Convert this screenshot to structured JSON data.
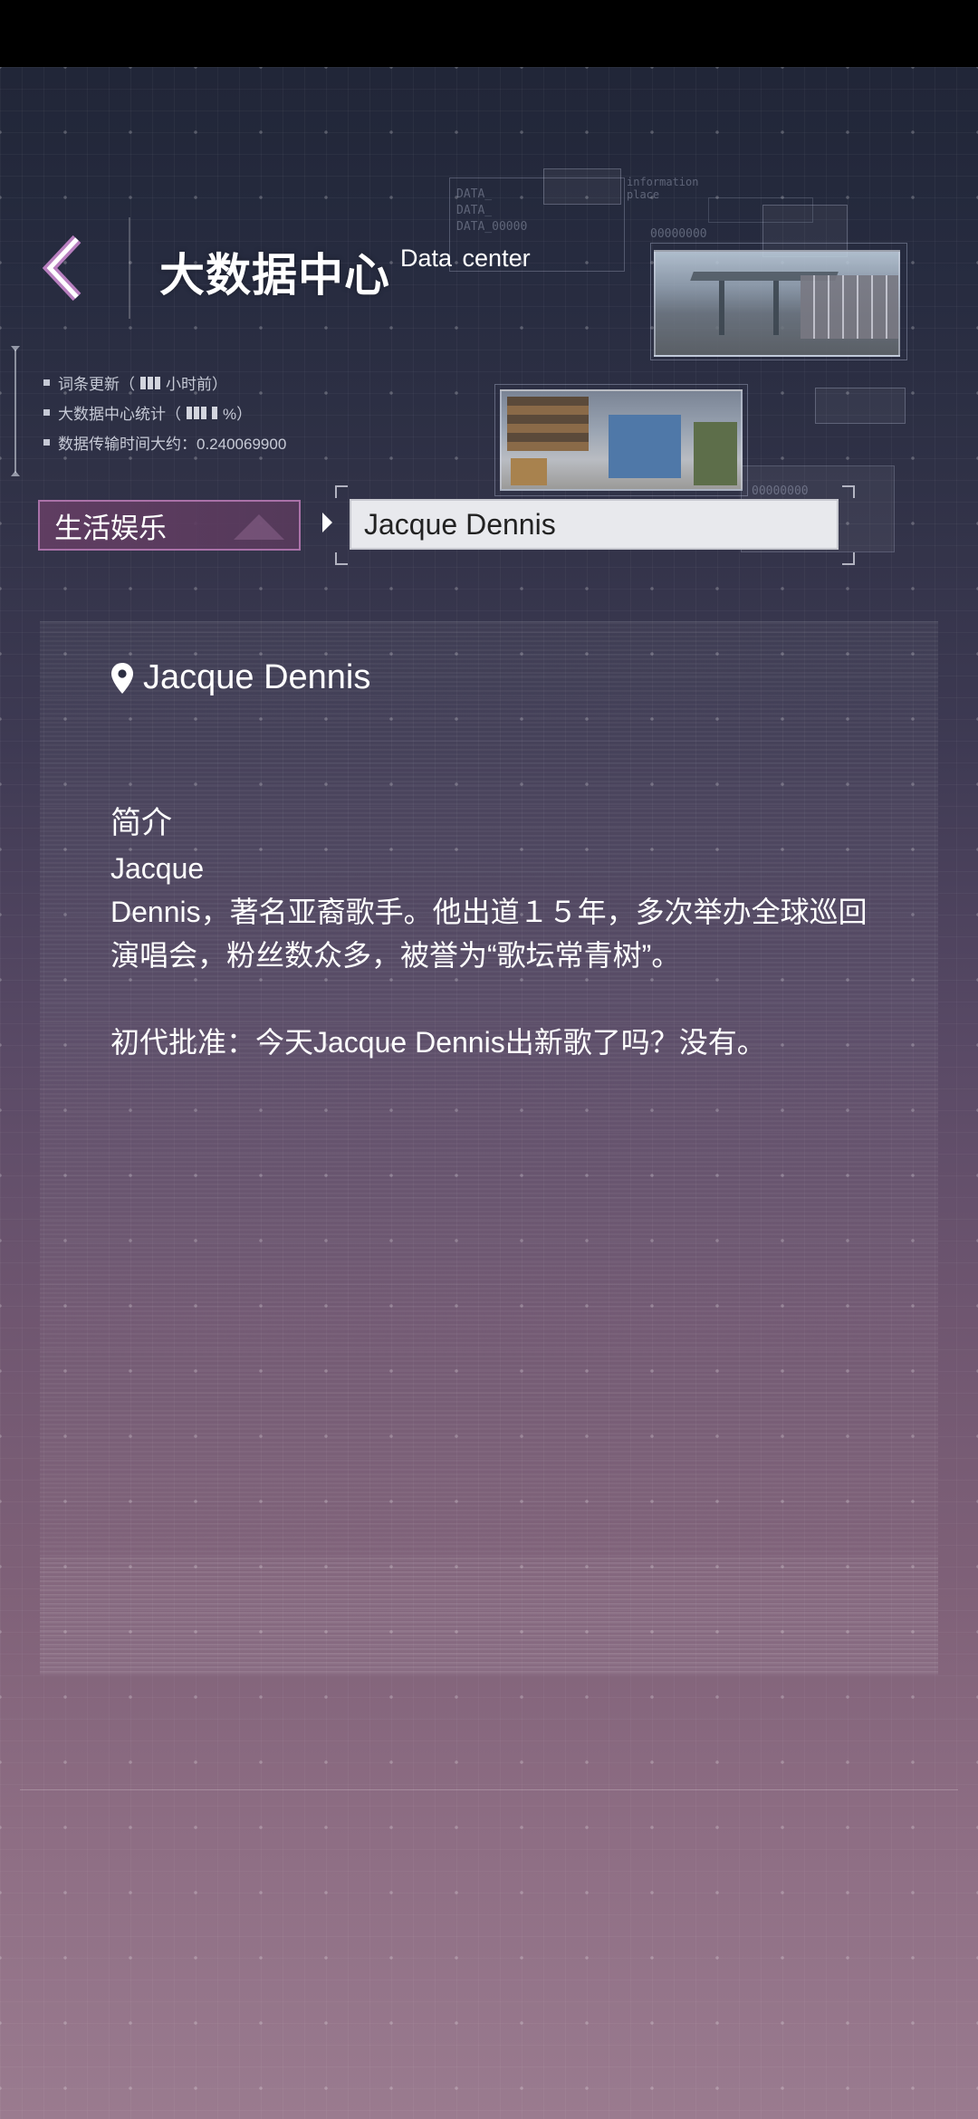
{
  "header": {
    "title": "大数据中心",
    "subtitle": "Data  center"
  },
  "hud": {
    "data_lines": "DATA_\nDATA_\nDATA_00000",
    "info_label": "information\nplace",
    "counter_1": "00000000",
    "counter_2": "00000000"
  },
  "stats": {
    "line1_label": "词条更新（",
    "line1_suffix": "小时前）",
    "line2_label": "大数据中心统计（",
    "line2_suffix": "%）",
    "line3": "数据传输时间大约：0.240069900"
  },
  "category": {
    "label": "生活娱乐"
  },
  "search": {
    "value": "Jacque Dennis"
  },
  "entry": {
    "name": "Jacque Dennis",
    "section_title": "简介",
    "paragraph_1": "Jacque\nDennis，著名亚裔歌手。他出道１５年，多次举办全球巡回演唱会，粉丝数众多，被誉为“歌坛常青树”。",
    "paragraph_2": "初代批准：今天Jacque Dennis出新歌了吗？没有。"
  },
  "icons": {
    "back": "chevron-left-icon",
    "location": "location-pin-icon"
  },
  "colors": {
    "category_border": "#b278b0",
    "category_bg": "#643e64",
    "input_bg": "#e8e9ed"
  }
}
